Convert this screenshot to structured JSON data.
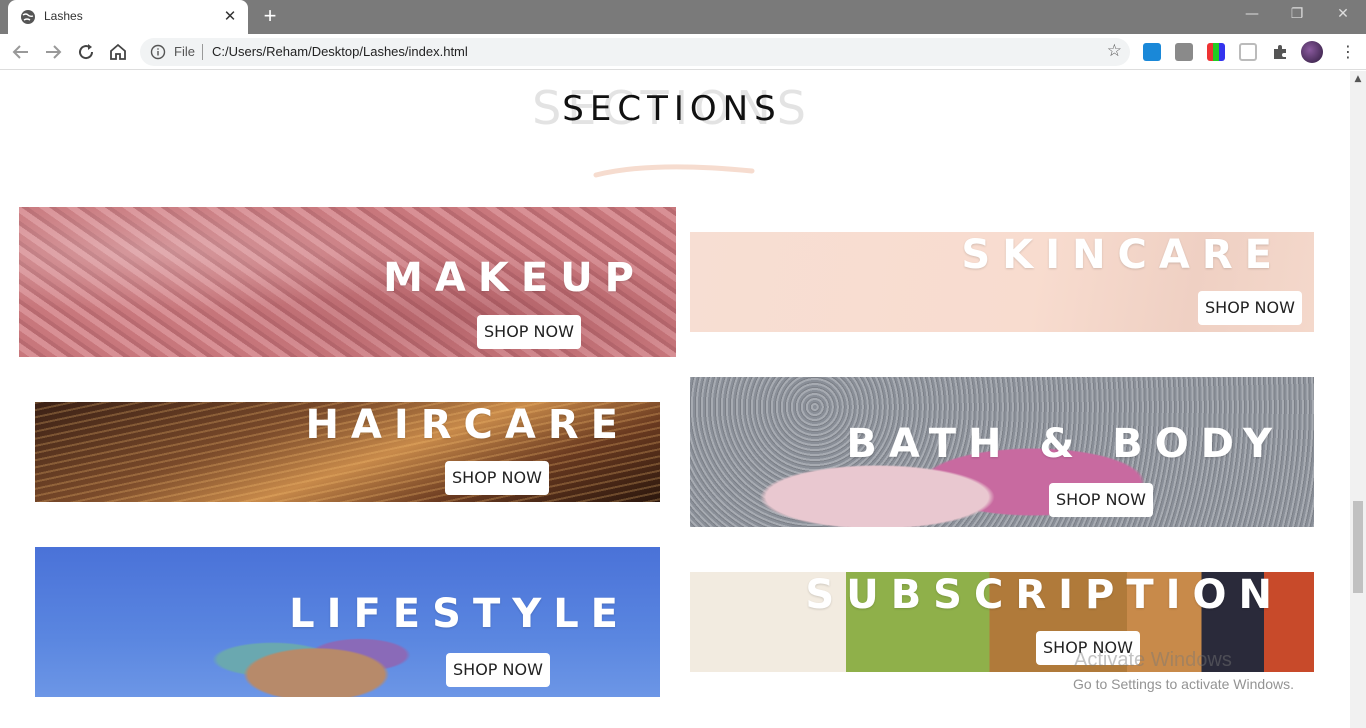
{
  "browser": {
    "tab_title": "Lashes",
    "tab_close": "✕",
    "new_tab": "+",
    "address_scheme": "File",
    "address_url": "C:/Users/Reham/Desktop/Lashes/index.html",
    "window_controls": {
      "minimize": "—",
      "restore": "❐",
      "close": "✕"
    },
    "menu": "⋮",
    "icons": [
      "back-arrow-icon",
      "forward-arrow-icon",
      "reload-icon",
      "home-icon",
      "info-icon",
      "star-icon",
      "download-extension-icon",
      "shopping-bag-extension-icon",
      "color-palette-extension-icon",
      "pocket-extension-icon",
      "puzzle-extensions-icon",
      "profile-avatar"
    ]
  },
  "page": {
    "section_ghost": "SECTIONS",
    "section_title": "SECTIONS",
    "accent_color": "#f6dccf",
    "categories": [
      {
        "label": "MAKEUP",
        "button": "SHOP NOW"
      },
      {
        "label": "SKINCARE",
        "button": "SHOP NOW"
      },
      {
        "label": "HAIRCARE",
        "button": "SHOP NOW"
      },
      {
        "label": "BATH & BODY",
        "button": "SHOP NOW"
      },
      {
        "label": "LIFESTYLE",
        "button": "SHOP NOW"
      },
      {
        "label": "SUBSCRIPTION",
        "button": "SHOP NOW"
      }
    ]
  },
  "watermark": {
    "line1": "Activate Windows",
    "line2": "Go to Settings to activate Windows."
  }
}
